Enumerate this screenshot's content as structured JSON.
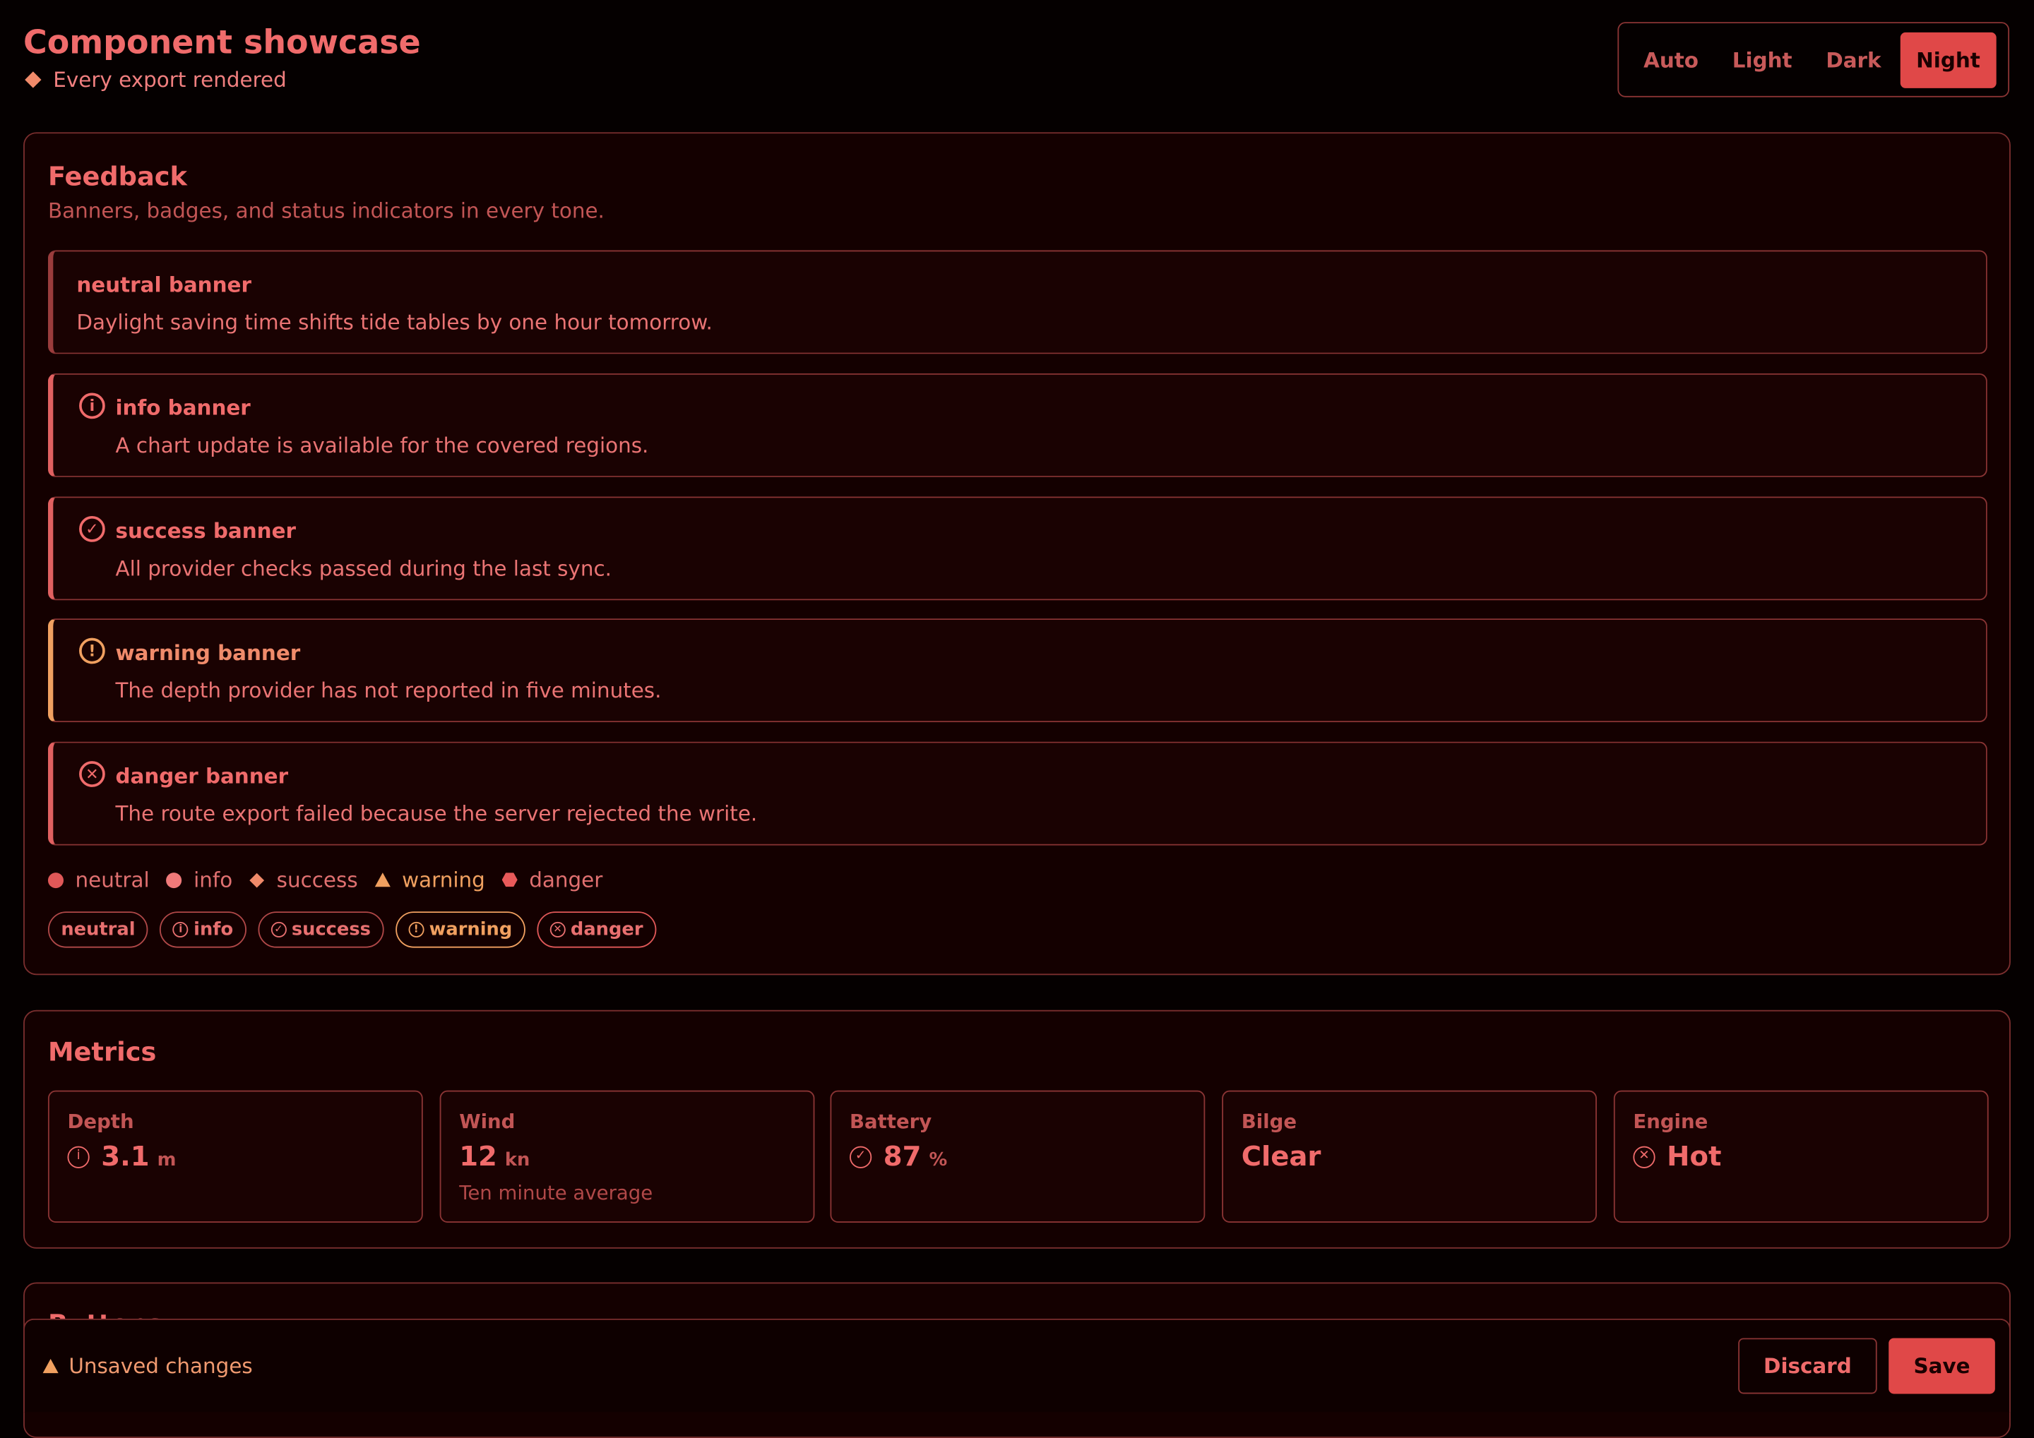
{
  "header": {
    "title": "Component showcase",
    "subtitle": "Every export rendered",
    "themes": [
      "Auto",
      "Light",
      "Dark",
      "Night"
    ],
    "active_theme": "Night"
  },
  "feedback": {
    "title": "Feedback",
    "subtitle": "Banners, badges, and status indicators in every tone.",
    "banners": [
      {
        "tone": "neutral",
        "title": "neutral banner",
        "message": "Daylight saving time shifts tide tables by one hour tomorrow.",
        "icon": "none"
      },
      {
        "tone": "info",
        "title": "info banner",
        "message": "A chart update is available for the covered regions.",
        "icon": "info-icon"
      },
      {
        "tone": "success",
        "title": "success banner",
        "message": "All provider checks passed during the last sync.",
        "icon": "check-icon"
      },
      {
        "tone": "warning",
        "title": "warning banner",
        "message": "The depth provider has not reported in five minutes.",
        "icon": "exclamation-icon"
      },
      {
        "tone": "danger",
        "title": "danger banner",
        "message": "The route export failed because the server rejected the write.",
        "icon": "x-icon"
      }
    ],
    "status_dots": [
      "neutral",
      "info",
      "success",
      "warning",
      "danger"
    ],
    "badges": [
      "neutral",
      "info",
      "success",
      "warning",
      "danger"
    ]
  },
  "metrics": {
    "title": "Metrics",
    "items": [
      {
        "label": "Depth",
        "value": "3.1",
        "unit": "m",
        "icon": "info-icon",
        "hint": ""
      },
      {
        "label": "Wind",
        "value": "12",
        "unit": "kn",
        "icon": "",
        "hint": "Ten minute average"
      },
      {
        "label": "Battery",
        "value": "87",
        "unit": "%",
        "icon": "check-icon",
        "hint": ""
      },
      {
        "label": "Bilge",
        "value": "Clear",
        "unit": "",
        "icon": "",
        "hint": ""
      },
      {
        "label": "Engine",
        "value": "Hot",
        "unit": "",
        "icon": "x-icon",
        "hint": ""
      }
    ]
  },
  "buttons_section": {
    "title": "Buttons"
  },
  "save_bar": {
    "status": "Unsaved changes",
    "discard_label": "Discard",
    "save_label": "Save"
  },
  "colors": {
    "background": "#050000",
    "card": "#140000",
    "accent": "#e04848",
    "text": "#f06b6b",
    "warning": "#f0a060"
  }
}
